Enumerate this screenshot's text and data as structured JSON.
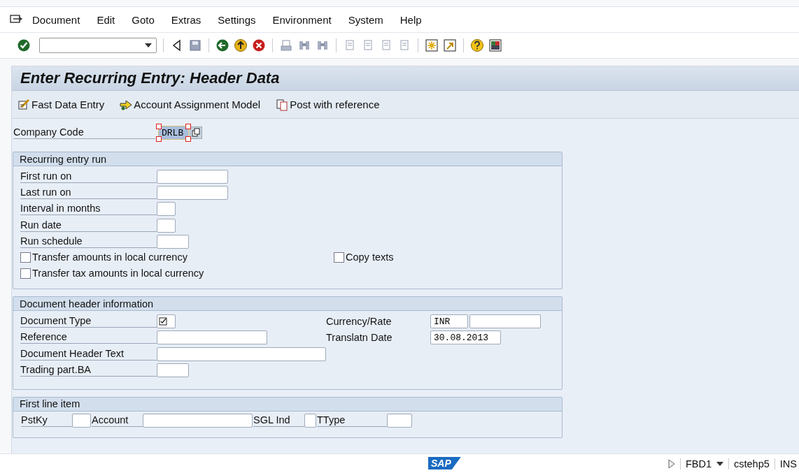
{
  "menu": [
    "Document",
    "Edit",
    "Goto",
    "Extras",
    "Settings",
    "Environment",
    "System",
    "Help"
  ],
  "title": "Enter Recurring Entry: Header Data",
  "app_toolbar": [
    {
      "label": "Fast Data Entry",
      "kind": "fast"
    },
    {
      "label": "Account Assignment Model",
      "kind": "model"
    },
    {
      "label": "Post with reference",
      "kind": "reference"
    }
  ],
  "company_code": {
    "label": "Company Code",
    "value": "DRLB"
  },
  "recurring_run": {
    "title": "Recurring entry run",
    "fields": [
      {
        "label": "First run on"
      },
      {
        "label": "Last run on"
      },
      {
        "label": "Interval in months"
      },
      {
        "label": "Run date"
      },
      {
        "label": "Run schedule"
      }
    ],
    "checkboxes": [
      {
        "label": "Transfer amounts in local currency",
        "checked": false
      },
      {
        "label": "Copy texts",
        "checked": false
      },
      {
        "label": "Transfer tax amounts in local currency",
        "checked": false
      }
    ]
  },
  "document_header": {
    "title": "Document header information",
    "fields": [
      {
        "label": "Document Type"
      },
      {
        "label": "Reference"
      },
      {
        "label": "Document Header Text"
      },
      {
        "label": "Trading part.BA"
      }
    ],
    "currency_rate": {
      "label": "Currency/Rate",
      "currency": "INR"
    },
    "translation_date": {
      "label": "Translatn Date",
      "value": "30.08.2013"
    }
  },
  "first_line_item": {
    "title": "First line item",
    "fields": [
      {
        "label": "PstKy"
      },
      {
        "label": "Account"
      },
      {
        "label": "SGL Ind"
      },
      {
        "label": "TType"
      }
    ]
  },
  "status_bar": {
    "logo": "SAP",
    "transaction": "FBD1",
    "server": "cstehp5",
    "mode": "INS"
  }
}
